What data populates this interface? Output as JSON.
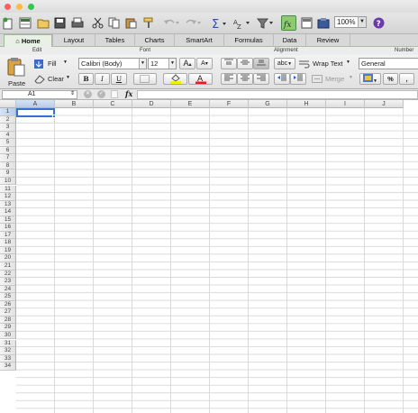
{
  "window": {
    "close_color": "#fc605c",
    "minimize_color": "#fdbc40",
    "zoom_color": "#34c84a"
  },
  "toolbar": {
    "zoom_value": "100%",
    "icons": [
      "new-workbook-icon",
      "templates-icon",
      "open-icon",
      "save-icon",
      "print-icon",
      "cut-icon",
      "copy-icon",
      "paste-icon",
      "format-painter-icon",
      "undo-icon",
      "redo-icon",
      "autosum-icon",
      "sort-icon",
      "filter-icon",
      "formula-builder-icon",
      "show-gallery-icon",
      "toolbox-icon",
      "help-icon"
    ]
  },
  "ribbon_tabs": [
    {
      "label": "Home",
      "active": true
    },
    {
      "label": "Layout"
    },
    {
      "label": "Tables"
    },
    {
      "label": "Charts"
    },
    {
      "label": "SmartArt"
    },
    {
      "label": "Formulas"
    },
    {
      "label": "Data"
    },
    {
      "label": "Review"
    }
  ],
  "groups": {
    "edit": "Edit",
    "font": "Font",
    "alignment": "Alignment",
    "number": "Number"
  },
  "edit": {
    "paste": "Paste",
    "fill": "Fill",
    "clear": "Clear"
  },
  "font": {
    "name": "Calibri (Body)",
    "size": "12",
    "bold": "B",
    "italic": "I",
    "underline": "U",
    "grow": "A",
    "shrink": "A"
  },
  "alignment": {
    "abc": "abc",
    "wrap": "Wrap Text",
    "merge": "Merge"
  },
  "number": {
    "format": "General",
    "percent": "%",
    "comma": ","
  },
  "formula_bar": {
    "cell_ref": "A1",
    "fx": "fx",
    "value": ""
  },
  "columns": [
    "A",
    "B",
    "C",
    "D",
    "E",
    "F",
    "G",
    "H",
    "I",
    "J"
  ],
  "rows": [
    "1",
    "2",
    "3",
    "4",
    "5",
    "6",
    "7",
    "8",
    "9",
    "10",
    "11",
    "12",
    "13",
    "14",
    "15",
    "16",
    "17",
    "18",
    "19",
    "20",
    "21",
    "22",
    "23",
    "24",
    "25",
    "26",
    "27",
    "28",
    "29",
    "30",
    "31",
    "32",
    "33",
    "34"
  ],
  "selected_cell": "A1",
  "colors": {
    "accent": "#3b6fd6",
    "ribbon_green": "#a0b898",
    "fill_yellow": "#f5f000",
    "font_red": "#e02020"
  }
}
